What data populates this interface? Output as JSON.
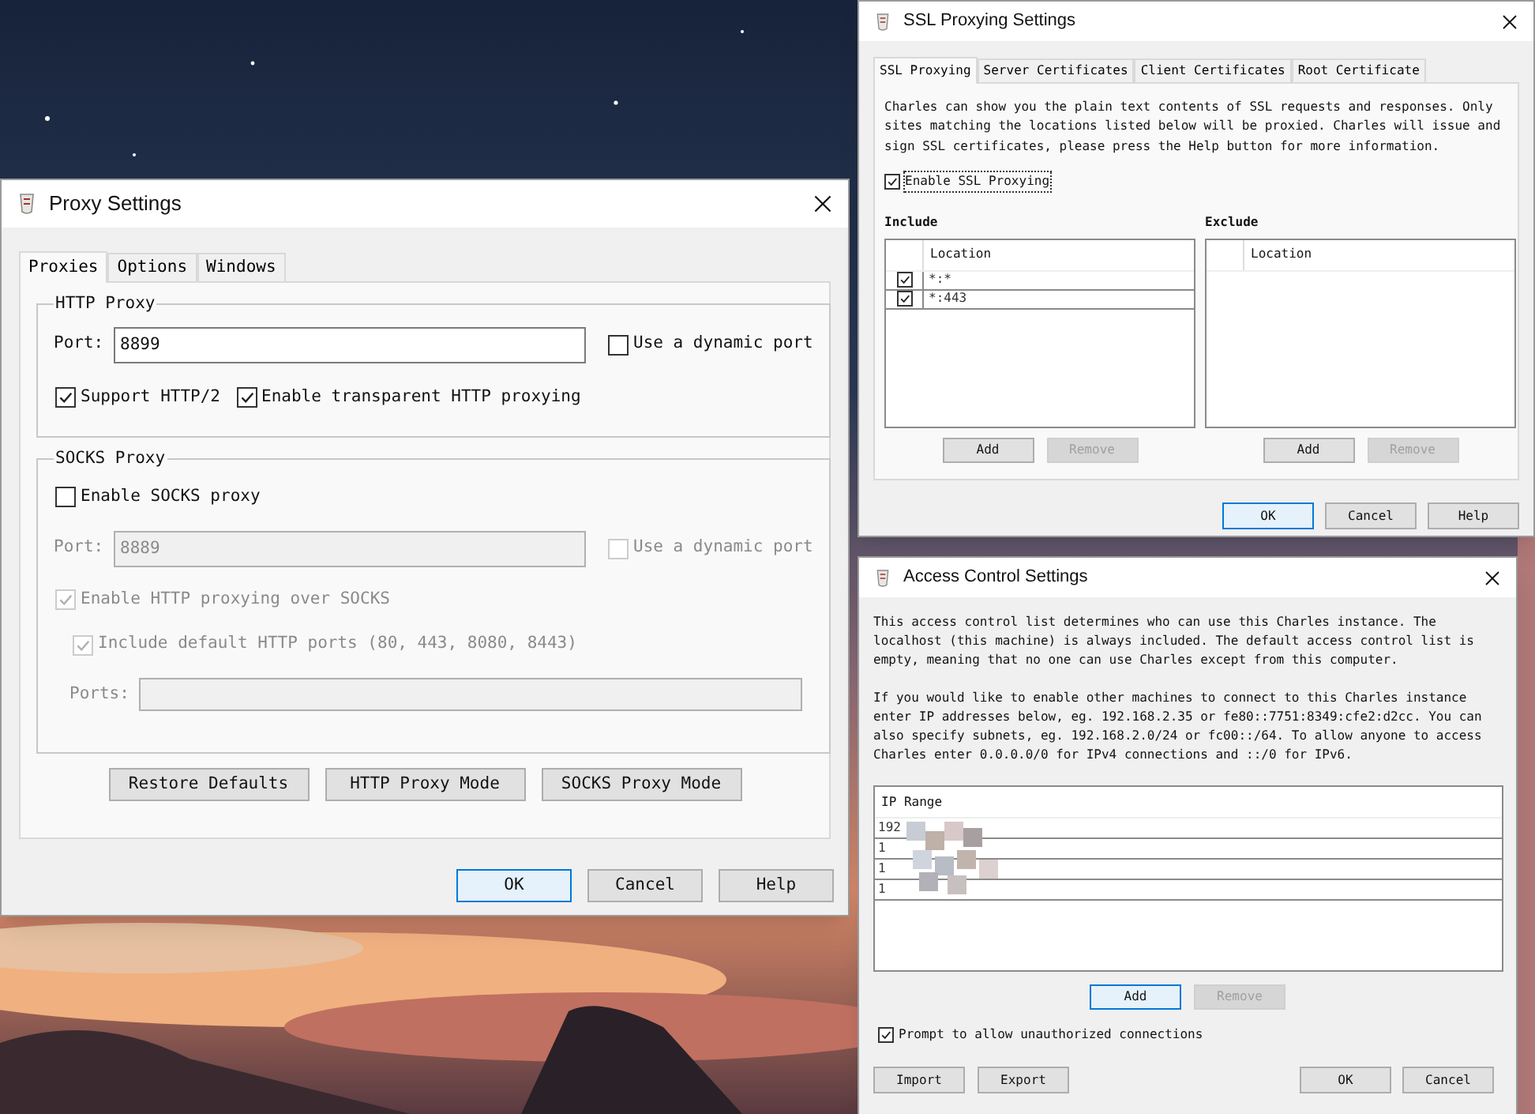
{
  "proxy_settings": {
    "title": "Proxy Settings",
    "tabs": [
      {
        "label": "Proxies",
        "selected": true
      },
      {
        "label": "Options",
        "selected": false
      },
      {
        "label": "Windows",
        "selected": false
      }
    ],
    "http_proxy": {
      "title": "HTTP Proxy",
      "port_label": "Port:",
      "port_value": "8899",
      "dynamic_port": {
        "label": "Use a dynamic port",
        "checked": false,
        "disabled": false
      },
      "options": [
        {
          "label": "Support HTTP/2",
          "checked": true,
          "disabled": false
        },
        {
          "label": "Enable transparent HTTP proxying",
          "checked": true,
          "disabled": false
        }
      ]
    },
    "socks_proxy": {
      "title": "SOCKS Proxy",
      "enable": {
        "label": "Enable SOCKS proxy",
        "checked": false,
        "disabled": false
      },
      "port_label": "Port:",
      "port_value": "8889",
      "port_disabled": true,
      "dynamic_port": {
        "label": "Use a dynamic port",
        "checked": false,
        "disabled": true
      },
      "http_over_socks": {
        "label": "Enable HTTP proxying over SOCKS",
        "checked": true,
        "disabled": true
      },
      "include_default_ports": {
        "label": "Include default HTTP ports (80, 443, 8080, 8443)",
        "checked": true,
        "disabled": true
      },
      "ports_label": "Ports:"
    },
    "mode_buttons": [
      {
        "label": "Restore Defaults",
        "focused": false,
        "disabled": false
      },
      {
        "label": "HTTP Proxy Mode",
        "focused": false,
        "disabled": false
      },
      {
        "label": "SOCKS Proxy Mode",
        "focused": false,
        "disabled": false
      }
    ],
    "buttons": [
      {
        "label": "OK",
        "focused": true,
        "disabled": false
      },
      {
        "label": "Cancel",
        "focused": false,
        "disabled": false
      },
      {
        "label": "Help",
        "focused": false,
        "disabled": false
      }
    ]
  },
  "ssl_proxying_settings": {
    "title": "SSL Proxying Settings",
    "tabs": [
      {
        "label": "SSL Proxying",
        "selected": true
      },
      {
        "label": "Server Certificates",
        "selected": false
      },
      {
        "label": "Client Certificates",
        "selected": false
      },
      {
        "label": "Root Certificate",
        "selected": false
      }
    ],
    "description": "Charles can show you the plain text contents of SSL requests and responses. Only sites matching the locations listed below will be proxied. Charles will issue and sign SSL certificates, please press the Help button for more information.",
    "enable_ssl": {
      "label": "Enable SSL Proxying",
      "checked": true,
      "disabled": false
    },
    "include": {
      "title": "Include",
      "column": "Location",
      "rows": [
        {
          "location": "*:*",
          "checked": true
        },
        {
          "location": "*:443",
          "checked": true
        }
      ],
      "buttons": [
        {
          "label": "Add",
          "focused": false,
          "disabled": false
        },
        {
          "label": "Remove",
          "focused": false,
          "disabled": true
        }
      ]
    },
    "exclude": {
      "title": "Exclude",
      "column": "Location",
      "buttons": [
        {
          "label": "Add",
          "focused": false,
          "disabled": false
        },
        {
          "label": "Remove",
          "focused": false,
          "disabled": true
        }
      ]
    },
    "buttons": [
      {
        "label": "OK",
        "focused": true,
        "disabled": false
      },
      {
        "label": "Cancel",
        "focused": false,
        "disabled": false
      },
      {
        "label": "Help",
        "focused": false,
        "disabled": false
      }
    ]
  },
  "access_control_settings": {
    "title": "Access Control Settings",
    "paragraphs": [
      "This access control list determines who can use this Charles instance. The localhost (this machine) is always included. The default access control list is empty, meaning that no one can use Charles except from this computer.",
      "If you would like to enable other machines to connect to this Charles instance enter IP addresses below, eg. 192.168.2.35 or fe80::7751:8349:cfe2:d2cc. You can also specify subnets, eg. 192.168.2.0/24 or fc00::/64. To allow anyone to access Charles enter 0.0.0.0/0 for IPv4 connections and ::/0 for IPv6."
    ],
    "column": "IP Range",
    "rows": [
      {
        "ip_range": "192"
      },
      {
        "ip_range": "1"
      },
      {
        "ip_range": "1"
      },
      {
        "ip_range": "1"
      }
    ],
    "list_buttons": [
      {
        "label": "Add",
        "focused": true,
        "disabled": false
      },
      {
        "label": "Remove",
        "focused": false,
        "disabled": true
      }
    ],
    "prompt": {
      "label": "Prompt to allow unauthorized connections",
      "checked": true,
      "disabled": false
    },
    "left_buttons": [
      {
        "label": "Import",
        "focused": false,
        "disabled": false
      },
      {
        "label": "Export",
        "focused": false,
        "disabled": false
      }
    ],
    "buttons": [
      {
        "label": "OK",
        "focused": false,
        "disabled": false
      },
      {
        "label": "Cancel",
        "focused": false,
        "disabled": false
      }
    ]
  }
}
